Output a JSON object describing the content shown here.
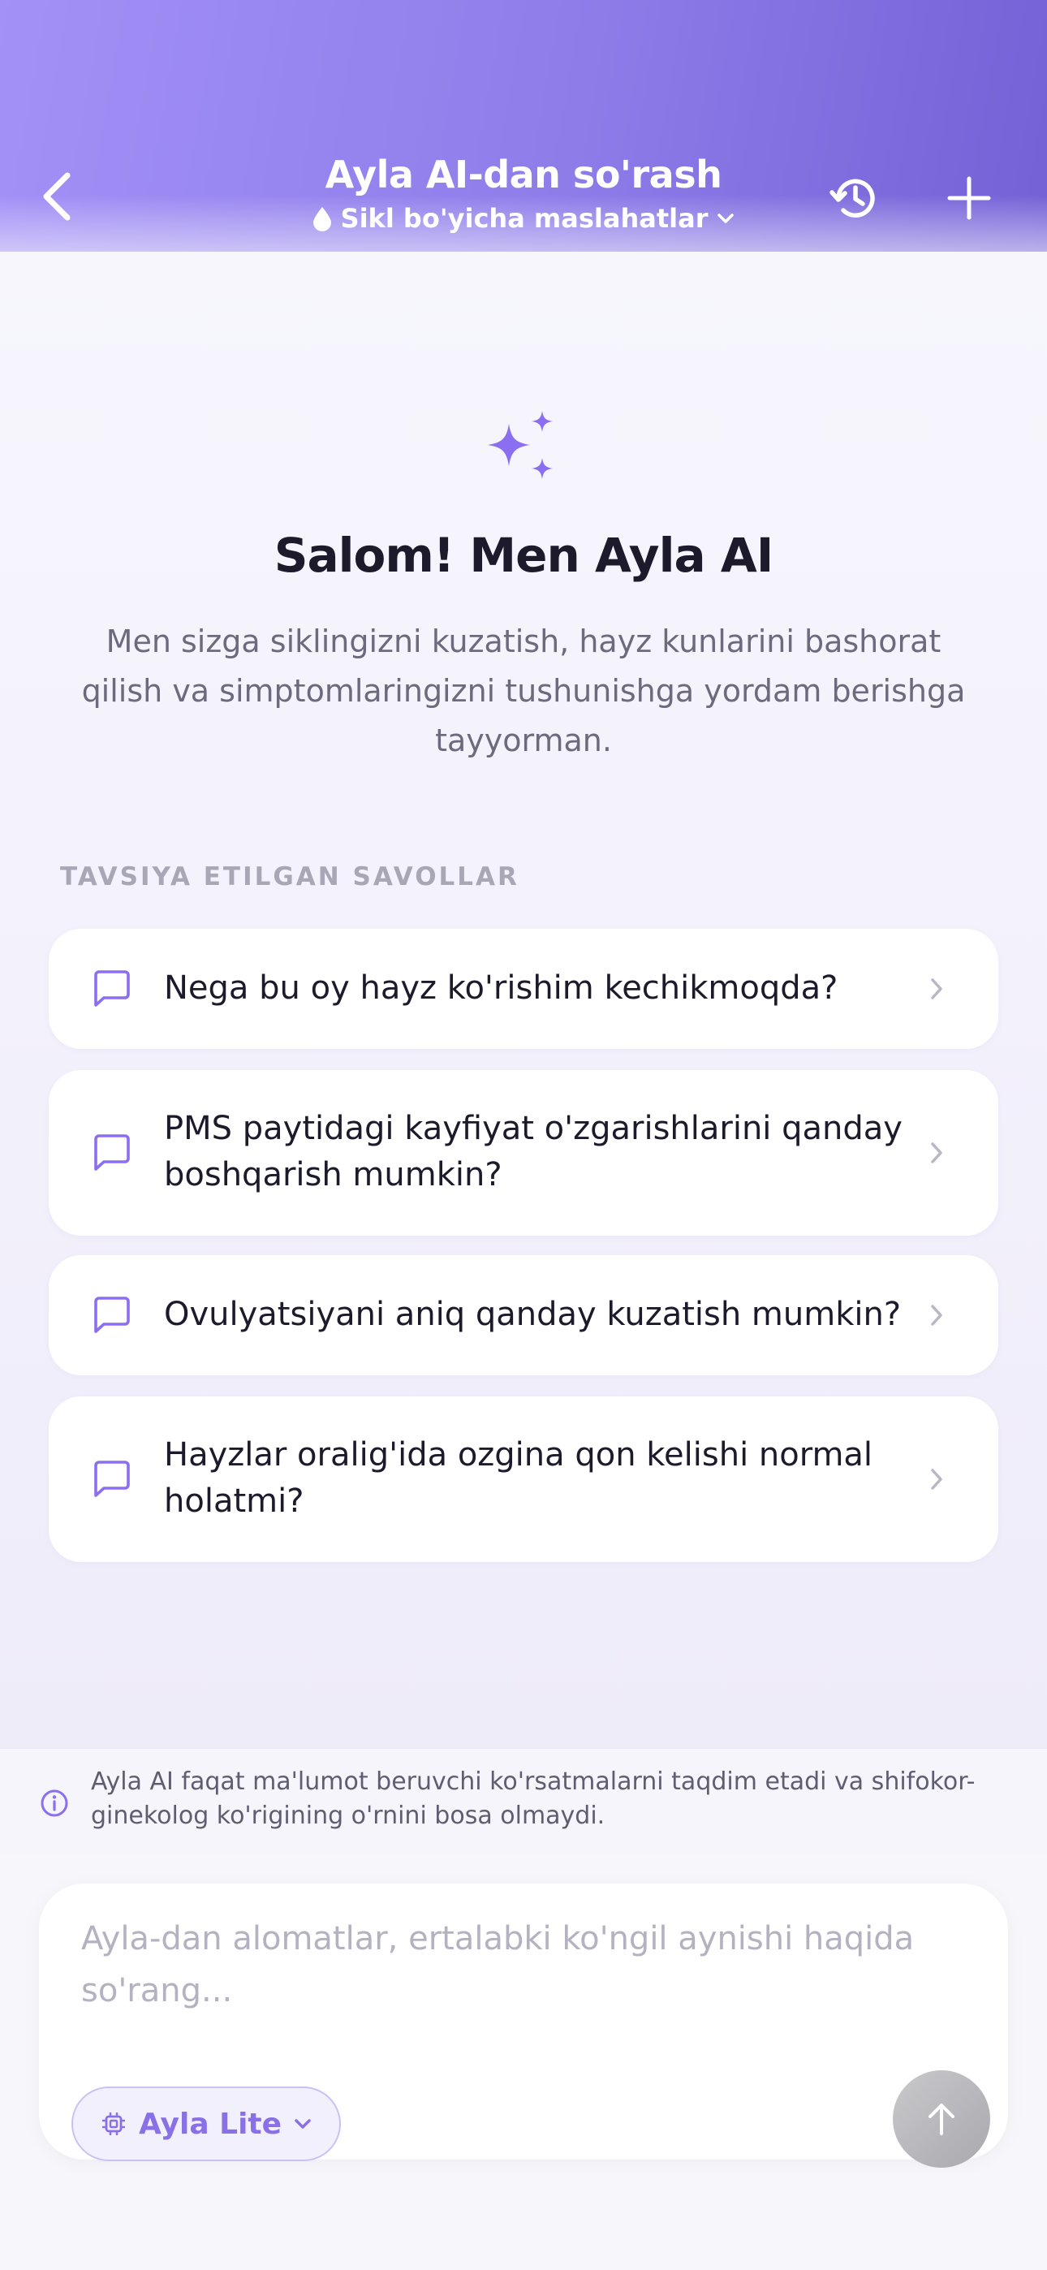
{
  "header": {
    "title": "Ayla AI-dan so'rash",
    "subtitle": "Sikl bo'yicha maslahatlar",
    "icons": {
      "back": "chevron-left-icon",
      "subtitle": "drop-icon",
      "subtitle_dropdown": "chevron-down-icon",
      "history": "history-icon",
      "new_chat": "plus-icon"
    }
  },
  "welcome": {
    "icon": "sparkles-icon",
    "title": "Salom! Men Ayla AI",
    "text": "Men sizga siklingizni kuzatish, hayz kunlarini bashorat qilish va simptomlaringizni tushunishga yordam berishga tayyorman."
  },
  "suggestions": {
    "label": "TAVSIYA ETILGAN SAVOLLAR",
    "items": [
      {
        "text": "Nega bu oy hayz ko'rishim kechikmoqda?"
      },
      {
        "text": "PMS paytidagi kayfiyat o'zgarishlarini qanday boshqarish mumkin?"
      },
      {
        "text": "Ovulyatsiyani aniq qanday kuzatish mumkin?"
      },
      {
        "text": "Hayzlar oralig'ida ozgina qon kelishi normal holatmi?"
      }
    ]
  },
  "disclaimer": {
    "icon": "info-icon",
    "text": "Ayla AI faqat ma'lumot beruvchi ko'rsatmalarni taqdim etadi va shifokor-ginekolog ko'rigining o'rnini bosa olmaydi."
  },
  "composer": {
    "value": "",
    "placeholder": "Ayla-dan alomatlar, ertalabki ko'ngil aynishi haqida so'rang...",
    "model_label": "Ayla Lite",
    "send_icon": "arrow-up-icon"
  },
  "colors": {
    "accent": "#8a70e6",
    "header_start": "#a391f7",
    "header_end": "#7461d6",
    "send_disabled": "#b8b8bc"
  }
}
